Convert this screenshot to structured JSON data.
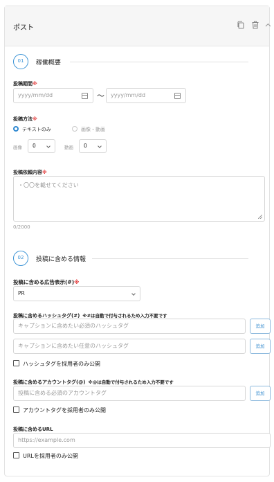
{
  "header": {
    "title": "ポスト"
  },
  "section1": {
    "number": "01",
    "title": "稼働概要",
    "period": {
      "label": "投稿期間",
      "start_placeholder": "yyyy/mm/dd",
      "separator": "〜",
      "end_placeholder": "yyyy/mm/dd"
    },
    "method": {
      "label": "投稿方法",
      "option_text": "テキストのみ",
      "option_media": "画像・動画",
      "selected": "テキストのみ"
    },
    "image_count": {
      "label": "画像",
      "value": "0"
    },
    "video_count": {
      "label": "動画",
      "value": "0"
    },
    "content": {
      "label": "投稿依頼内容",
      "placeholder": "・〇〇を載せてください",
      "counter": "0/2000"
    }
  },
  "section2": {
    "number": "02",
    "title": "投稿に含める情報",
    "ad_display": {
      "label": "投稿に含める広告表示(#)",
      "value": "PR"
    },
    "hashtag": {
      "label": "投稿に含めるハッシュタグ(#)",
      "note": "※#は自動で付与されるため入力不要です",
      "required_placeholder": "キャプションに含めたい必須のハッシュタグ",
      "optional_placeholder": "キャプションに含めたい任意のハッシュタグ",
      "add_label": "追加",
      "checkbox_label": "ハッシュタグを採用者のみ公開"
    },
    "account_tag": {
      "label": "投稿に含めるアカウントタグ(@)",
      "note": "※@は自動で付与されるため入力不要です",
      "placeholder": "投稿に含める必須のアカウントタグ",
      "add_label": "追加",
      "checkbox_label": "アカウントタグを採用者のみ公開"
    },
    "url": {
      "label": "投稿に含めるURL",
      "placeholder": "https://example.com",
      "checkbox_label": "URLを採用者のみ公開"
    }
  },
  "required_mark": "※",
  "colors": {
    "accent": "#3c94d6",
    "required": "#e23a3a",
    "header_bg": "#f6f6f6"
  }
}
